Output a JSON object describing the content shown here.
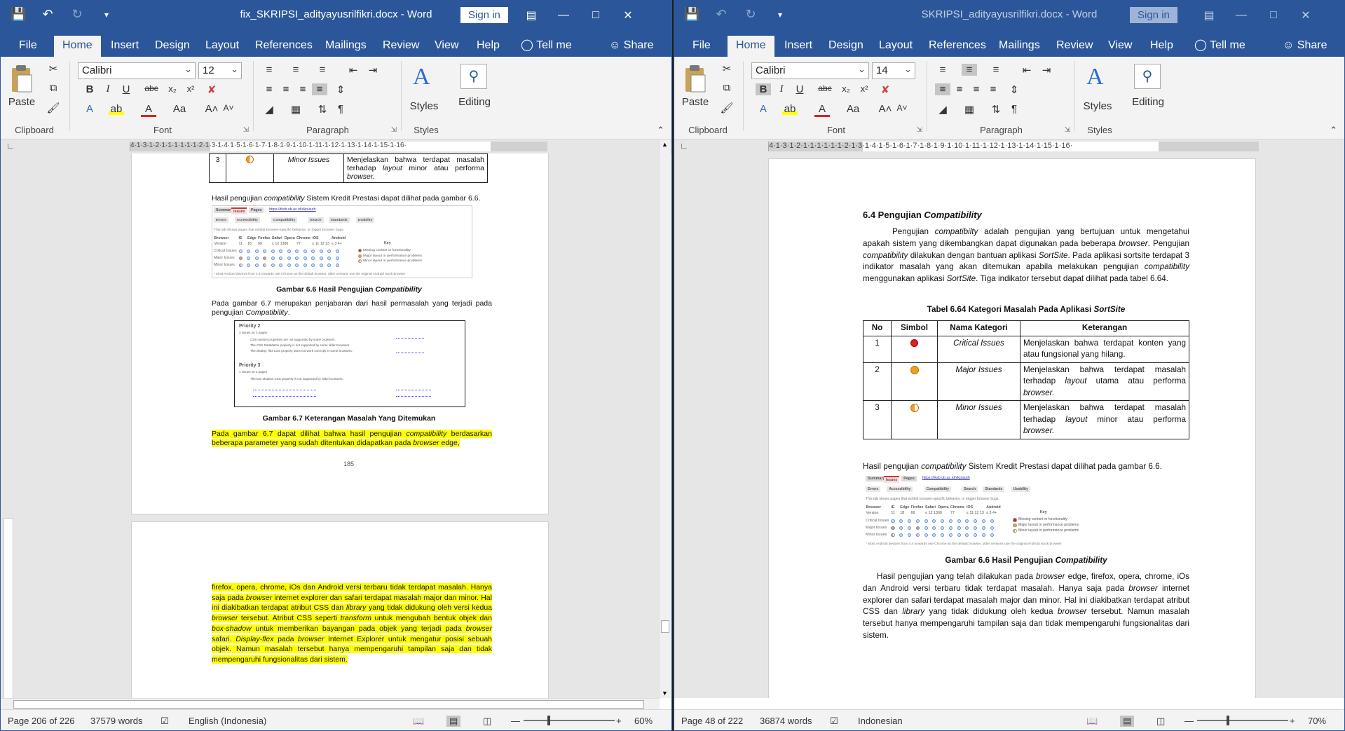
{
  "left": {
    "title": "fix_SKRIPSI_adityayusrilfikri.docx",
    "app": "Word",
    "signin": "Sign in",
    "tabs": [
      "File",
      "Home",
      "Insert",
      "Design",
      "Layout",
      "References",
      "Mailings",
      "Review",
      "View",
      "Help"
    ],
    "tellme": "Tell me",
    "share": "Share",
    "font_name": "Calibri",
    "font_size": "12",
    "group_labels": [
      "Clipboard",
      "Font",
      "Paragraph",
      "Styles"
    ],
    "paste": "Paste",
    "styles": "Styles",
    "editing": "Editing",
    "ruler_text": "4·1·3·1·2·1·1·1·1·1·1·2·1·3·1·4·1·5·1·6·1·7·1·8·1·9·1·10·1·11·1·12·1·13·1·14·1·15·1·16·",
    "status": {
      "page": "Page 206 of 226",
      "words": "37579 words",
      "language": "English (Indonesia)",
      "zoom": "60%"
    },
    "doc": {
      "table_row": {
        "no": "3",
        "cat": "Minor Issues",
        "desc_a": "Menjelaskan bahwa terdapat masalah terhadap ",
        "desc_layout": "layout",
        "desc_b": " minor atau performa ",
        "desc_browser": "browser."
      },
      "p1a": "Hasil pengujian ",
      "p1b": "compatibility",
      "p1c": " Sistem Kredit Prestasi dapat dilihat pada gambar 6.6.",
      "cap66a": "Gambar 6.6 Hasil Pengujian ",
      "cap66b": "Compatibility",
      "p2a": "Pada gambar 6.7 merupakan penjabaran dari hasil permasalah yang terjadi pada pengujian ",
      "p2b": "Compatibility",
      "p2c": ".",
      "cap67": "Gambar 6.7 Keterangan Masalah Yang Ditemukan",
      "p3a": "Pada gambar 6.7 dapat dilihat bahwa hasil pengujian ",
      "p3b": "compatibility",
      "p3c": " berdasarkan beberapa parameter yang sudah ditentukan didapatkan pada ",
      "p3d": "browser",
      "p3e": " edge,",
      "page_no": "185",
      "p4": [
        "firefox, opera, chrome, iOs dan Android versi terbaru tidak terdapat masalah. Hanya saja pada ",
        "browser",
        " internet explorer dan safari terdapat masalah major dan minor. Hal ini diakibatkan terdapat atribut CSS dan ",
        "library",
        " yang tidak didukung oleh versi kedua ",
        "browser",
        " tersebut. Atribut CSS seperti ",
        "transform",
        " untuk mengubah bentuk objek dan ",
        "box-shadow",
        " untuk memberikan bayangan pada objek yang terjadi pada ",
        "browser",
        " safari. ",
        "Display-flex",
        " pada ",
        "browser",
        " Internet Explorer untuk mengatur posisi sebuah objek. Namun masalah tersebut hanya mempengaruhi tampilan saja dan tidak mempengaruhi fungsionalitas dari sistem."
      ]
    }
  },
  "right": {
    "title": "SKRIPSI_adityayusrilfikri.docx",
    "app": "Word",
    "signin": "Sign in",
    "tabs": [
      "File",
      "Home",
      "Insert",
      "Design",
      "Layout",
      "References",
      "Mailings",
      "Review",
      "View",
      "Help"
    ],
    "tellme": "Tell me",
    "share": "Share",
    "font_name": "Calibri",
    "font_size": "14",
    "group_labels": [
      "Clipboard",
      "Font",
      "Paragraph",
      "Styles"
    ],
    "paste": "Paste",
    "styles": "Styles",
    "editing": "Editing",
    "ruler_text": "4·1·3·1·2·1·1·1·1·1·1·2·1·3·1·4·1·5·1·6·1·7·1·8·1·9·1·10·1·11·1·12·1·13·1·14·1·15·1·16·",
    "status": {
      "page": "Page 48 of 222",
      "words": "36874 words",
      "language": "Indonesian",
      "zoom": "70%"
    },
    "doc": {
      "heading_a": "6.4 Pengujian ",
      "heading_b": "Compatibility",
      "p1": [
        "Pengujian ",
        "compatibilty",
        " adalah pengujian yang bertujuan untuk mengetahui apakah sistem yang dikembangkan dapat digunakan pada beberapa ",
        "browser",
        ". Pengujian ",
        "compatibility",
        " dilakukan dengan bantuan aplikasi ",
        "SortSite",
        ". Pada aplikasi sortsite terdapat 3 indikator masalah yang akan ditemukan apabila melakukan pengujian ",
        "compatibility",
        " menggunakan aplikasi ",
        "SortSite",
        ". Tiga indikator tersebut dapat dilihat pada tabel 6.64."
      ],
      "table_title_a": "Tabel 6.64 Kategori Masalah Pada Aplikasi ",
      "table_title_b": "SortSite",
      "headers": [
        "No",
        "Simbol",
        "Nama Kategori",
        "Keterangan"
      ],
      "rows": [
        {
          "no": "1",
          "cat": "Critical Issues",
          "a": "Menjelaskan bahwa terdapat konten yang atau fungsional yang hilang.",
          "b": "",
          "c": "",
          "d": ""
        },
        {
          "no": "2",
          "cat": "Major Issues",
          "a": "Menjelaskan bahwa terdapat masalah terhadap ",
          "b": "layout",
          "c": " utama atau performa ",
          "d": "browser."
        },
        {
          "no": "3",
          "cat": "Minor Issues",
          "a": "Menjelaskan bahwa terdapat masalah terhadap ",
          "b": "layout",
          "c": " minor atau performa ",
          "d": "browser."
        }
      ],
      "p2a": "Hasil pengujian ",
      "p2b": "compatibility",
      "p2c": " Sistem Kredit Prestasi dapat dilihat pada gambar 6.6.",
      "cap66a": "Gambar 6.6 Hasil Pengujian ",
      "cap66b": "Compatibility",
      "p3": [
        "Hasil pengujian yang telah dilakukan pada ",
        "browser",
        " edge, firefox, opera, chrome, iOs dan Android versi terbaru tidak terdapat masalah. Hanya saja pada ",
        "browser",
        " internet explorer dan safari terdapat masalah major dan minor. Hal ini diakibatkan terdapat atribut CSS dan ",
        "library",
        " yang tidak didukung oleh kedua ",
        "browser",
        " tersebut. Namun masalah tersebut hanya mempengaruhi tampilan saja dan tidak mempengaruhi fungsionalitas dari sistem."
      ]
    }
  },
  "screenshot": {
    "tabs": [
      "Summary",
      "Issues",
      "Pages"
    ],
    "url": "https://tksb.ub.ac.id/skp/auth",
    "subtabs": [
      "Errors",
      "Accessibility",
      "Compatibility",
      "Search",
      "Standards",
      "Usability"
    ],
    "intro": "This tab shows pages that exhibit browser-specific behavior, or trigger browser bugs.",
    "cols": [
      "Browser",
      "IE",
      "Edge",
      "Firefox",
      "Safari",
      "Opera",
      "Chrome",
      "iOS",
      "Android"
    ],
    "version": [
      "Version",
      "11",
      "18",
      "69",
      "≤ 12 13",
      "60",
      "77",
      "≤ 11 12 13",
      "≤ 3 4+"
    ],
    "rowlabels": [
      "Critical Issues",
      "Major Issues",
      "Minor Issues"
    ],
    "key": "Key",
    "keys": [
      "Missing content or functionality",
      "Major layout or performance problems",
      "Minor layout or performance problems"
    ],
    "foot": "* Most Android devices from 4.4 onwards use Chrome as the default browser, older versions use the original Android stock browser",
    "p67_title": "Priority 2",
    "p67_sub": "3 issues on 3 pages",
    "p67_lines": [
      "CSS custom properties are not supported by some browsers.",
      "The CSS DataMatrix property is not supported by some older browsers.",
      "The display: flex CSS property does not work correctly in some browsers."
    ],
    "p67_title2": "Priority 3",
    "p67_sub2": "1 issues on 2 pages",
    "p67_line2": "The box-shadow CSS property is not supported by older browsers."
  },
  "colors": {
    "brand": "#2b579a",
    "highlight": "#ffff00",
    "critical": "#e02020",
    "major": "#f0a020"
  }
}
